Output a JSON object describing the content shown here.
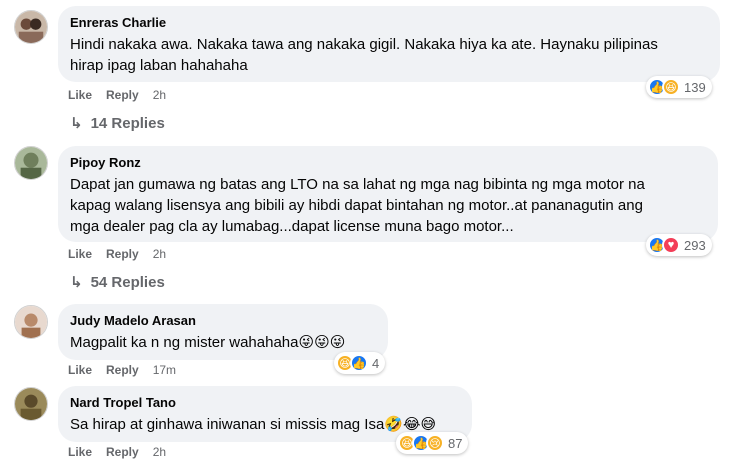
{
  "comments": [
    {
      "author": "Enreras Charlie",
      "text": "Hindi nakaka awa. Nakaka tawa ang nakaka gigil. Nakaka hiya ka ate. Haynaku pilipinas\nhirap ipag laban hahahaha",
      "like_label": "Like",
      "reply_label": "Reply",
      "time": "2h",
      "reaction_icons": [
        "like-icon",
        "haha-icon"
      ],
      "reaction_count": "139",
      "replies_label": "14 Replies"
    },
    {
      "author": "Pipoy Ronz",
      "text": "Dapat jan gumawa ng batas ang LTO na sa lahat ng mga nag bibinta ng mga motor na\nkapag walang lisensya ang bibili ay hibdi dapat bintahan ng motor..at pananagutin ang\nmga dealer pag cla ay lumabag...dapat license muna bago motor...",
      "like_label": "Like",
      "reply_label": "Reply",
      "time": "2h",
      "reaction_icons": [
        "like-icon",
        "heart-icon"
      ],
      "reaction_count": "293",
      "replies_label": "54 Replies"
    },
    {
      "author": "Judy Madelo Arasan",
      "text": "Magpalit ka n ng mister wahahaha😜😜😜",
      "like_label": "Like",
      "reply_label": "Reply",
      "time": "17m",
      "reaction_icons": [
        "haha-icon",
        "like-icon"
      ],
      "reaction_count": "4"
    },
    {
      "author": "Nard Tropel Tano",
      "text": "Sa hirap at ginhawa iniwanan si missis mag Isa🤣😂😅",
      "like_label": "Like",
      "reply_label": "Reply",
      "time": "2h",
      "reaction_icons": [
        "haha-icon",
        "like-icon",
        "sad-icon"
      ],
      "reaction_count": "87"
    }
  ],
  "colors": {
    "bubble_bg": "#f0f2f5",
    "like_blue": "#1877f2",
    "heart_red": "#f33e58",
    "haha_yellow": "#f7b125",
    "muted_text": "#65676b"
  }
}
